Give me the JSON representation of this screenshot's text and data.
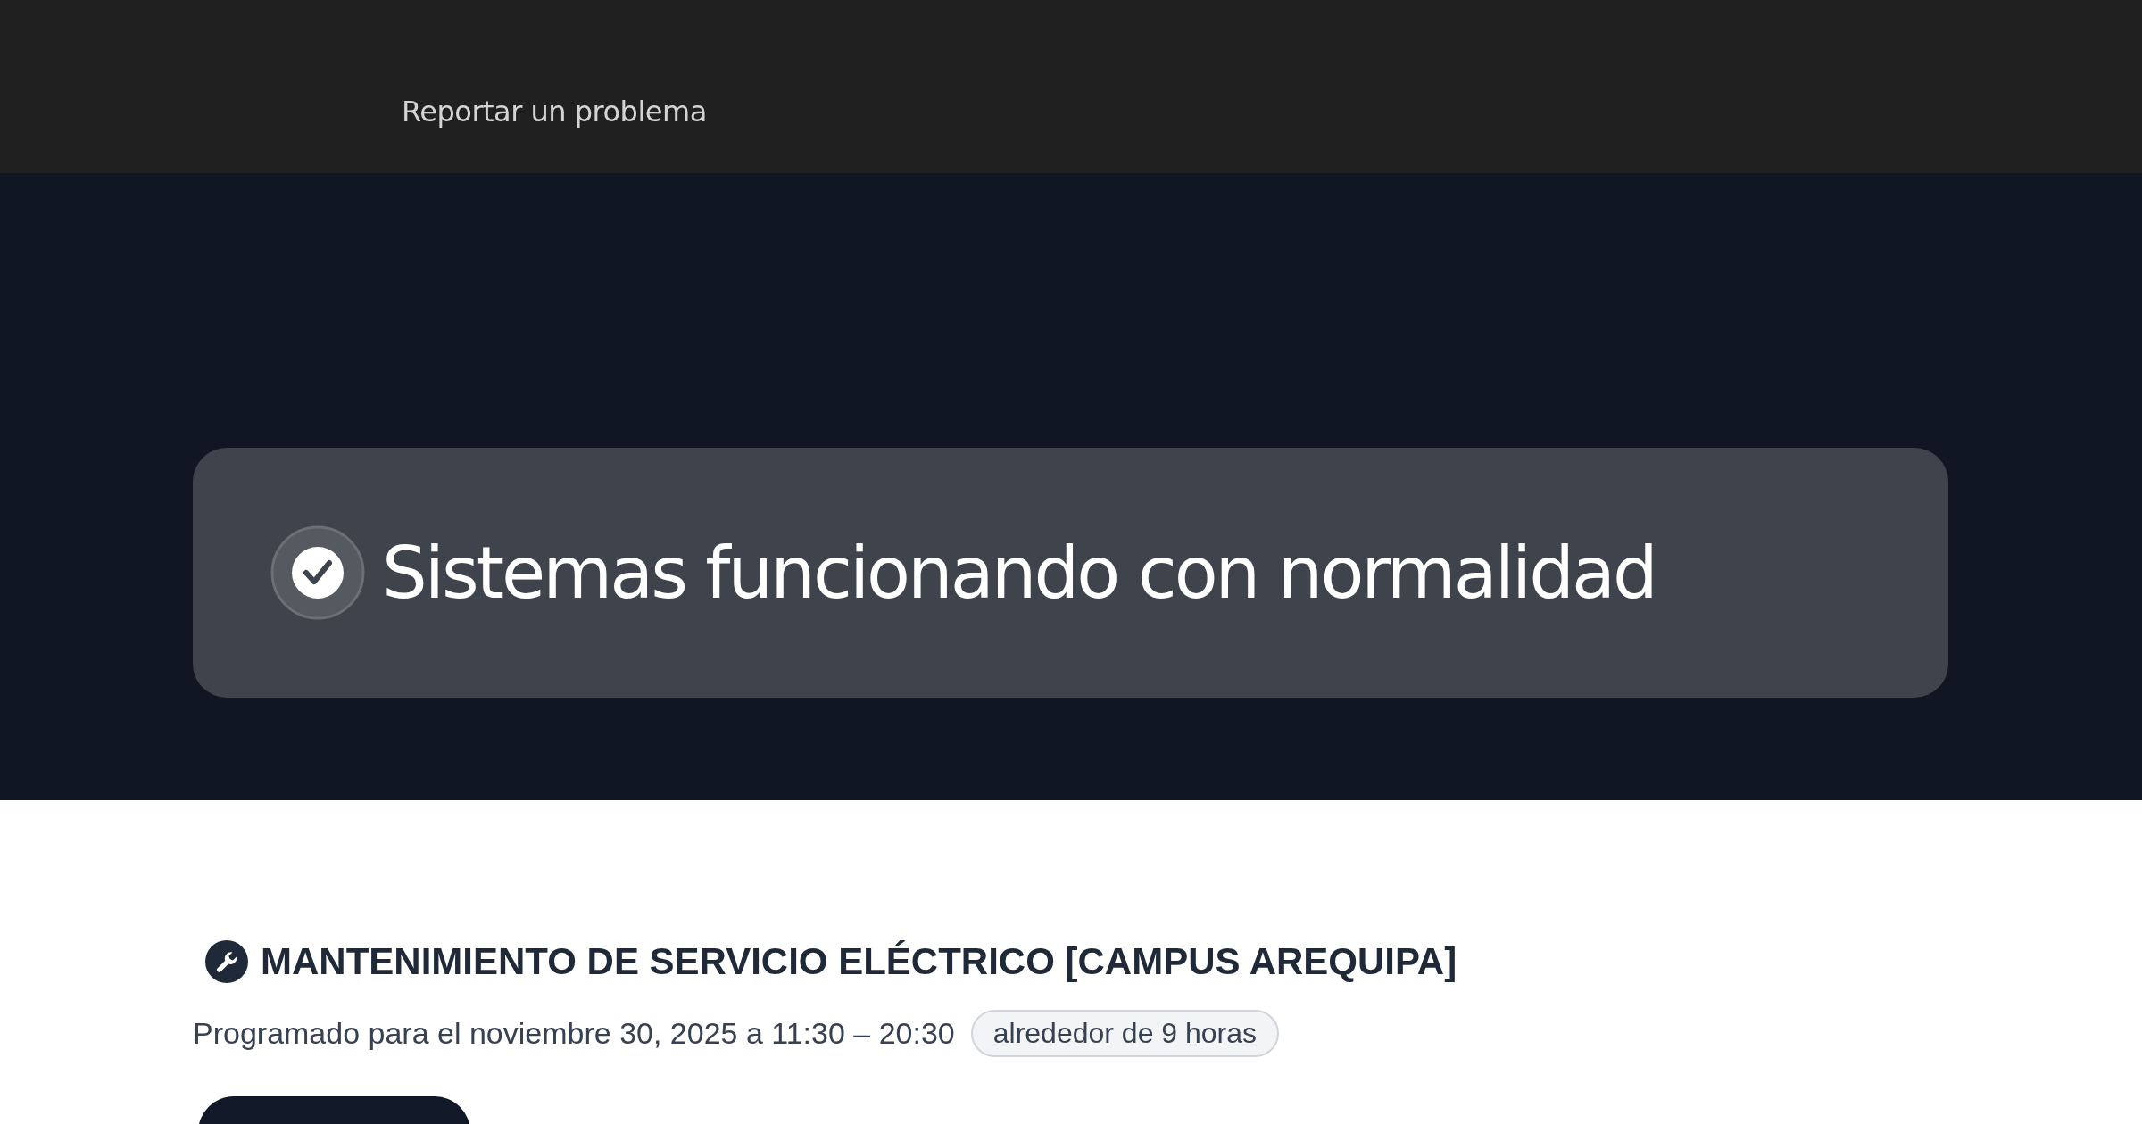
{
  "header": {
    "links": [
      {
        "label": "Reportar un problema"
      }
    ]
  },
  "status": {
    "kind": "operational",
    "title": "Sistemas funcionando con normalidad"
  },
  "maintenance": {
    "title": "MANTENIMIENTO DE SERVICIO ELÉCTRICO [CAMPUS AREQUIPA]",
    "schedule": "Programado para el noviembre 30, 2025 a 11:30 – 20:30",
    "duration": "alrededor de 9 horas"
  }
}
